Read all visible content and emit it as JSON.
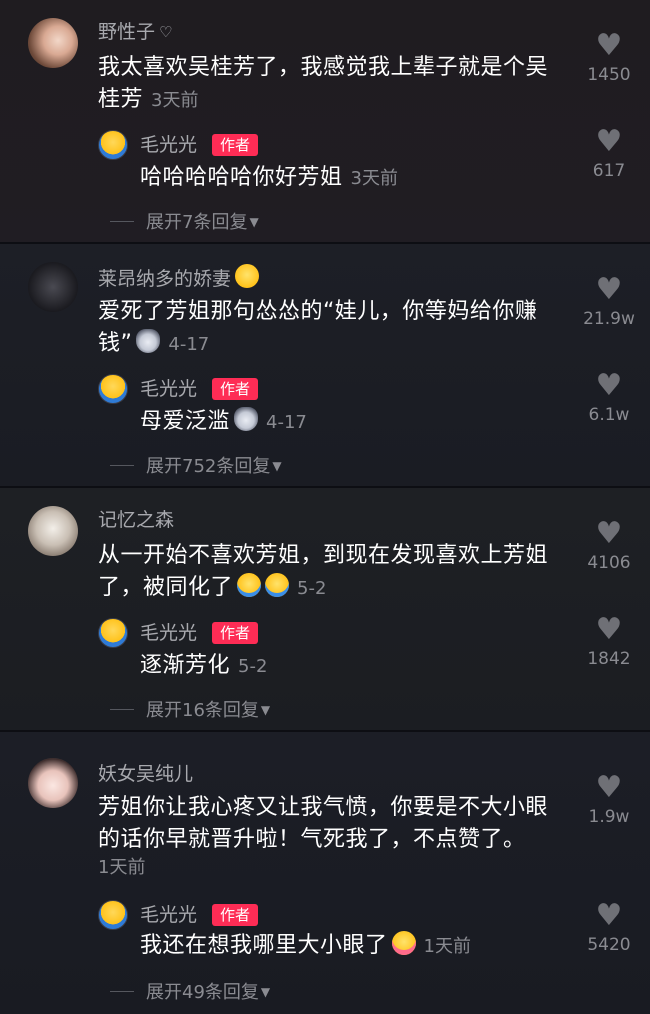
{
  "author_badge": "作者",
  "comments": [
    {
      "username": "野性子",
      "name_suffix": "♡",
      "text_line1": "我太喜欢吴桂芳了，我感觉我上辈子就是个吴",
      "text_line2": "桂芳",
      "time": "3天前",
      "likes": "1450",
      "reply": {
        "username": "毛光光",
        "text": "哈哈哈哈哈你好芳姐",
        "time": "3天前",
        "likes": "617"
      },
      "expand": "展开7条回复"
    },
    {
      "username": "莱昂纳多的娇妻",
      "name_emoji": "blush",
      "text_line1": "爱死了芳姐那句怂怂的“娃儿，你等妈给你赚",
      "text_line2": "钱”",
      "time": "4-17",
      "likes": "21.9w",
      "reply": {
        "username": "毛光光",
        "text": "母爱泛滥",
        "time": "4-17",
        "likes": "6.1w"
      },
      "expand": "展开752条回复"
    },
    {
      "username": "记忆之森",
      "text_line1": "从一开始不喜欢芳姐，到现在发现喜欢上芳姐",
      "text_line2": "了，被同化了",
      "time": "5-2",
      "likes": "4106",
      "reply": {
        "username": "毛光光",
        "text": "逐渐芳化",
        "time": "5-2",
        "likes": "1842"
      },
      "expand": "展开16条回复"
    },
    {
      "username": "妖女吴纯儿",
      "text_line1": "芳姐你让我心疼又让我气愤，你要是不大小眼",
      "text_line2": "的话你早就晋升啦！气死我了，不点赞了。",
      "time": "1天前",
      "likes": "1.9w",
      "reply": {
        "username": "毛光光",
        "text": "我还在想我哪里大小眼了",
        "time": "1天前",
        "likes": "5420"
      },
      "expand": "展开49条回复"
    }
  ],
  "icons": {
    "like": "heart-icon",
    "expand": "chevron-down-icon"
  },
  "colors": {
    "badge": "#fe2c55",
    "background": "#161823"
  }
}
